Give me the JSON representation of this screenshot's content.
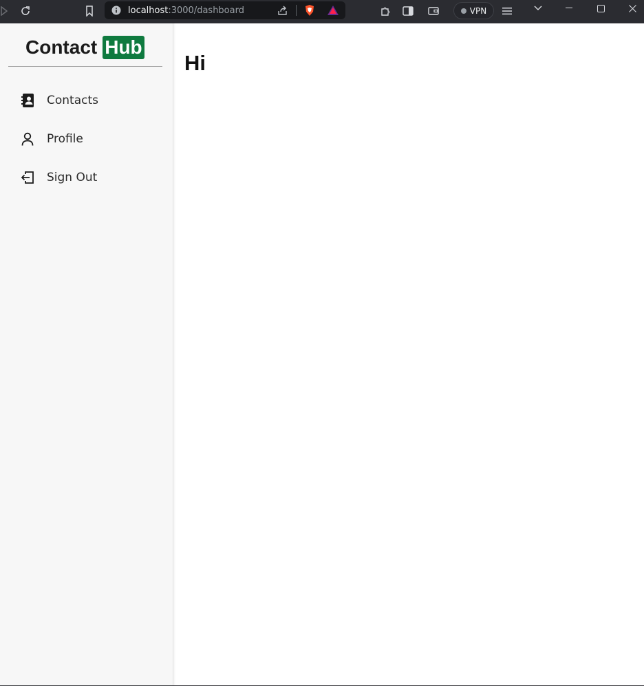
{
  "browser": {
    "url_host": "localhost",
    "url_path": ":3000/dashboard",
    "vpn_label": "VPN",
    "icons": [
      "forward-icon",
      "reload-icon",
      "bookmark-icon",
      "info-icon",
      "share-icon",
      "brave-shields-icon",
      "brave-rewards-icon",
      "extensions-icon",
      "sidebar-icon",
      "wallet-icon",
      "menu-icon",
      "tab-search-icon",
      "minimize-icon",
      "maximize-icon",
      "close-icon"
    ]
  },
  "sidebar": {
    "logo_text": "Contact",
    "logo_badge": "Hub",
    "logo_badge_color": "#0f7a3f",
    "items": [
      {
        "label": "Contacts",
        "icon": "contact-book-icon"
      },
      {
        "label": "Profile",
        "icon": "person-icon"
      },
      {
        "label": "Sign Out",
        "icon": "sign-out-icon"
      }
    ]
  },
  "main": {
    "title": "Hi"
  }
}
